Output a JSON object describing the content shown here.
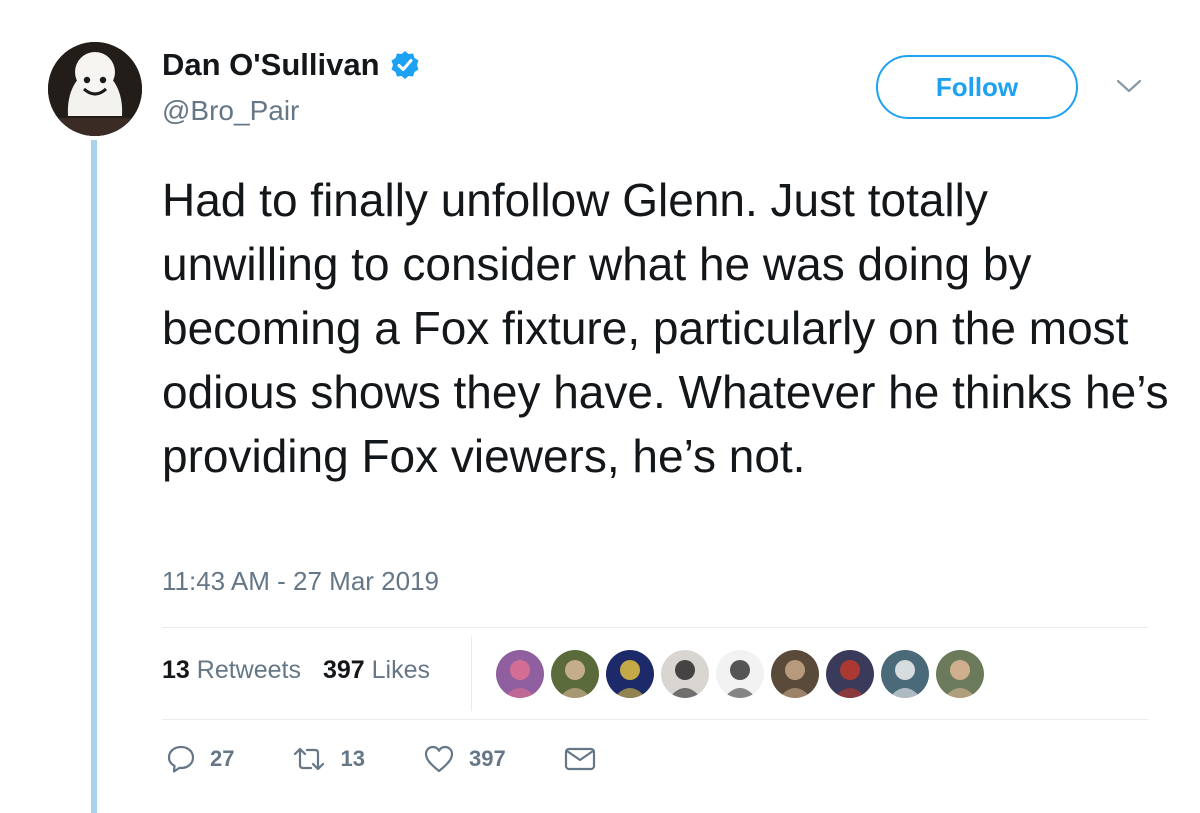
{
  "tweet": {
    "author": {
      "display_name": "Dan O'Sullivan",
      "handle": "@Bro_Pair",
      "verified": true,
      "avatar_icon": "ghost-avatar"
    },
    "follow_label": "Follow",
    "text": "Had to finally unfollow Glenn. Just totally unwilling to consider what he was doing by becoming a Fox fixture, particularly on the most odious shows they have. Whatever he thinks he’s providing Fox viewers, he’s not.",
    "timestamp": "11:43 AM - 27 Mar 2019",
    "stats": {
      "retweets_count": "13",
      "retweets_label": "Retweets",
      "likes_count": "397",
      "likes_label": "Likes"
    },
    "actions": {
      "reply_count": "27",
      "retweet_count": "13",
      "like_count": "397"
    },
    "likers": [
      {
        "bg": "#8f5fa0",
        "accent": "#e07090"
      },
      {
        "bg": "#5a6a3a",
        "accent": "#d8b89a"
      },
      {
        "bg": "#1c2a6a",
        "accent": "#e2c040"
      },
      {
        "bg": "#d9d6d2",
        "accent": "#2a2a2a"
      },
      {
        "bg": "#f2f2f2",
        "accent": "#3a3a3a"
      },
      {
        "bg": "#5a4a3a",
        "accent": "#c8a888"
      },
      {
        "bg": "#3a3a5a",
        "accent": "#c0392b"
      },
      {
        "bg": "#4a6a7a",
        "accent": "#f0f0f0"
      },
      {
        "bg": "#6a7a5a",
        "accent": "#e0b898"
      }
    ],
    "colors": {
      "accent": "#1da1f2",
      "thread_line": "#a8d4ea",
      "text": "#14171a",
      "secondary": "#657786"
    }
  }
}
